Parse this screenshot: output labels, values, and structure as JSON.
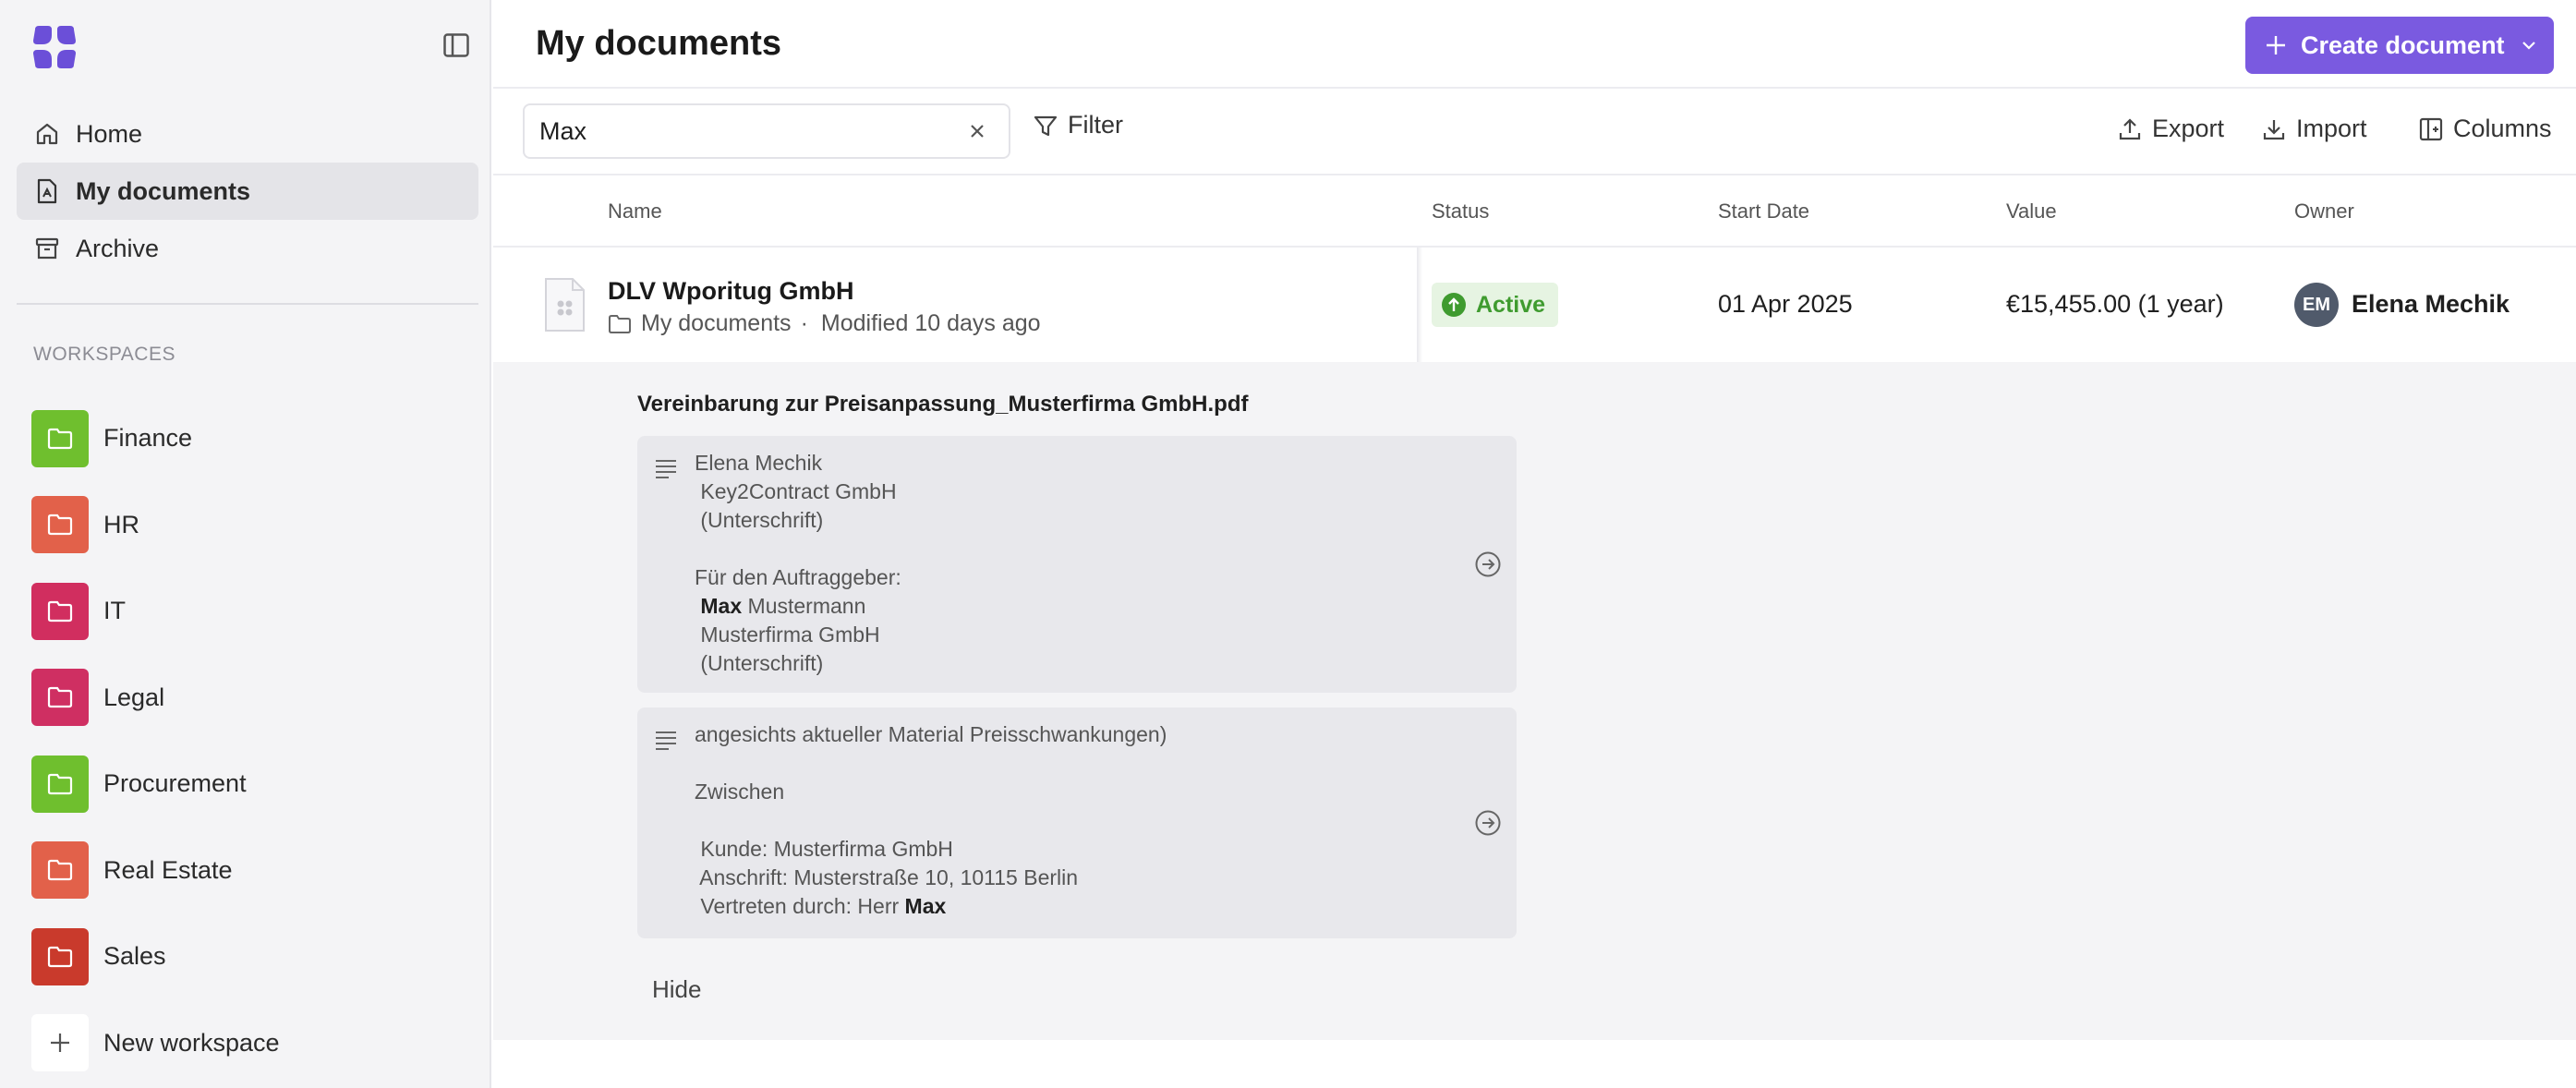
{
  "colors": {
    "accent": "#7a5ae0",
    "status_active": "#3f9b2f",
    "logo": "#6b4fd8"
  },
  "sidebar": {
    "logo_icon": "brand-logo-icon",
    "collapse_icon": "sidebar-toggle-icon",
    "nav": [
      {
        "label": "Home",
        "icon": "home-icon"
      },
      {
        "label": "My documents",
        "icon": "document-icon",
        "active": true
      },
      {
        "label": "Archive",
        "icon": "archive-icon"
      }
    ],
    "workspaces_heading": "WORKSPACES",
    "workspaces": [
      {
        "label": "Finance",
        "color": "#6fbf2e"
      },
      {
        "label": "HR",
        "color": "#e2614a"
      },
      {
        "label": "IT",
        "color": "#d12e5f"
      },
      {
        "label": "Legal",
        "color": "#cf2f62"
      },
      {
        "label": "Procurement",
        "color": "#6fbf2e"
      },
      {
        "label": "Real Estate",
        "color": "#e2614a"
      },
      {
        "label": "Sales",
        "color": "#c93a2c"
      }
    ],
    "new_workspace_label": "New workspace"
  },
  "header": {
    "title": "My documents",
    "create_label": "Create document"
  },
  "toolbar": {
    "search_value": "Max",
    "filter_label": "Filter",
    "export_label": "Export",
    "import_label": "Import",
    "columns_label": "Columns"
  },
  "table": {
    "columns": [
      "Name",
      "Status",
      "Start Date",
      "Value",
      "Owner"
    ],
    "row": {
      "name": "DLV Wporitug GmbH",
      "folder": "My documents",
      "separator": "·",
      "modified": "Modified 10 days ago",
      "status": "Active",
      "start_date": "01 Apr 2025",
      "value": "€15,455.00 (1 year)",
      "owner_initials": "EM",
      "owner_name": "Elena Mechik"
    }
  },
  "expanded": {
    "file_name": "Vereinbarung zur Preisanpassung_Musterfirma GmbH.pdf",
    "snippet1": {
      "line1": "Elena Mechik",
      "line2": " Key2Contract GmbH",
      "line3": " (Unterschrift)",
      "line5": "Für den Auftraggeber:",
      "line6_bold": "Max",
      "line6_rest": " Mustermann",
      "line7": " Musterfirma GmbH",
      "line8": " (Unterschrift)"
    },
    "snippet2": {
      "line1": "angesichts aktueller Material Preisschwankungen)",
      "line3": "Zwischen",
      "line5": " Kunde: Musterfirma GmbH",
      "line6": " Anschrift: Musterstraße 10, 10115 Berlin",
      "line7_rest": " Vertreten durch: Herr ",
      "line7_bold": "Max"
    },
    "hide_label": "Hide"
  }
}
